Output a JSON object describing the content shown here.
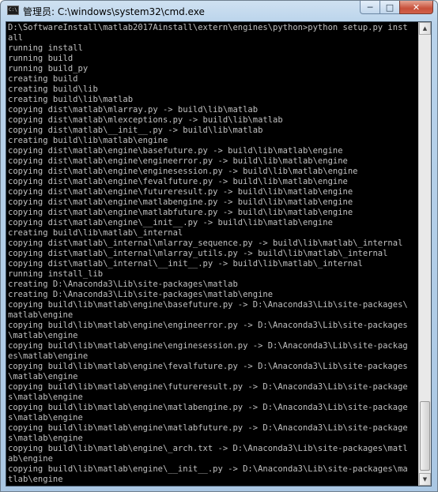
{
  "window": {
    "title": "管理员: C:\\windows\\system32\\cmd.exe",
    "app_icon_glyph": "C:\\",
    "buttons": {
      "minimize_icon": "─",
      "maximize_icon": "□",
      "close_icon": "✕"
    }
  },
  "console": {
    "lines": [
      "D:\\SoftwareInstall\\matlab2017Ainstall\\extern\\engines\\python>python setup.py inst",
      "all",
      "running install",
      "running build",
      "running build_py",
      "creating build",
      "creating build\\lib",
      "creating build\\lib\\matlab",
      "copying dist\\matlab\\mlarray.py -> build\\lib\\matlab",
      "copying dist\\matlab\\mlexceptions.py -> build\\lib\\matlab",
      "copying dist\\matlab\\__init__.py -> build\\lib\\matlab",
      "creating build\\lib\\matlab\\engine",
      "copying dist\\matlab\\engine\\basefuture.py -> build\\lib\\matlab\\engine",
      "copying dist\\matlab\\engine\\engineerror.py -> build\\lib\\matlab\\engine",
      "copying dist\\matlab\\engine\\enginesession.py -> build\\lib\\matlab\\engine",
      "copying dist\\matlab\\engine\\fevalfuture.py -> build\\lib\\matlab\\engine",
      "copying dist\\matlab\\engine\\futureresult.py -> build\\lib\\matlab\\engine",
      "copying dist\\matlab\\engine\\matlabengine.py -> build\\lib\\matlab\\engine",
      "copying dist\\matlab\\engine\\matlabfuture.py -> build\\lib\\matlab\\engine",
      "copying dist\\matlab\\engine\\__init__.py -> build\\lib\\matlab\\engine",
      "creating build\\lib\\matlab\\_internal",
      "copying dist\\matlab\\_internal\\mlarray_sequence.py -> build\\lib\\matlab\\_internal",
      "copying dist\\matlab\\_internal\\mlarray_utils.py -> build\\lib\\matlab\\_internal",
      "copying dist\\matlab\\_internal\\__init__.py -> build\\lib\\matlab\\_internal",
      "running install_lib",
      "creating D:\\Anaconda3\\Lib\\site-packages\\matlab",
      "creating D:\\Anaconda3\\Lib\\site-packages\\matlab\\engine",
      "copying build\\lib\\matlab\\engine\\basefuture.py -> D:\\Anaconda3\\Lib\\site-packages\\",
      "matlab\\engine",
      "copying build\\lib\\matlab\\engine\\engineerror.py -> D:\\Anaconda3\\Lib\\site-packages",
      "\\matlab\\engine",
      "copying build\\lib\\matlab\\engine\\enginesession.py -> D:\\Anaconda3\\Lib\\site-packag",
      "es\\matlab\\engine",
      "copying build\\lib\\matlab\\engine\\fevalfuture.py -> D:\\Anaconda3\\Lib\\site-packages",
      "\\matlab\\engine",
      "copying build\\lib\\matlab\\engine\\futureresult.py -> D:\\Anaconda3\\Lib\\site-package",
      "s\\matlab\\engine",
      "copying build\\lib\\matlab\\engine\\matlabengine.py -> D:\\Anaconda3\\Lib\\site-package",
      "s\\matlab\\engine",
      "copying build\\lib\\matlab\\engine\\matlabfuture.py -> D:\\Anaconda3\\Lib\\site-package",
      "s\\matlab\\engine",
      "copying build\\lib\\matlab\\engine\\_arch.txt -> D:\\Anaconda3\\Lib\\site-packages\\matl",
      "ab\\engine",
      "copying build\\lib\\matlab\\engine\\__init__.py -> D:\\Anaconda3\\Lib\\site-packages\\ma",
      "tlab\\engine"
    ]
  },
  "colors": {
    "console_bg": "#000000",
    "console_fg": "#c0c0c0",
    "close_button": "#c7503a",
    "title_bar": "#b9d3eb"
  },
  "icons": {
    "app": "cmd-icon",
    "minimize": "minimize-icon",
    "maximize": "maximize-icon",
    "close": "close-icon",
    "scroll_up": "scroll-up-arrow-icon",
    "scroll_down": "scroll-down-arrow-icon"
  }
}
